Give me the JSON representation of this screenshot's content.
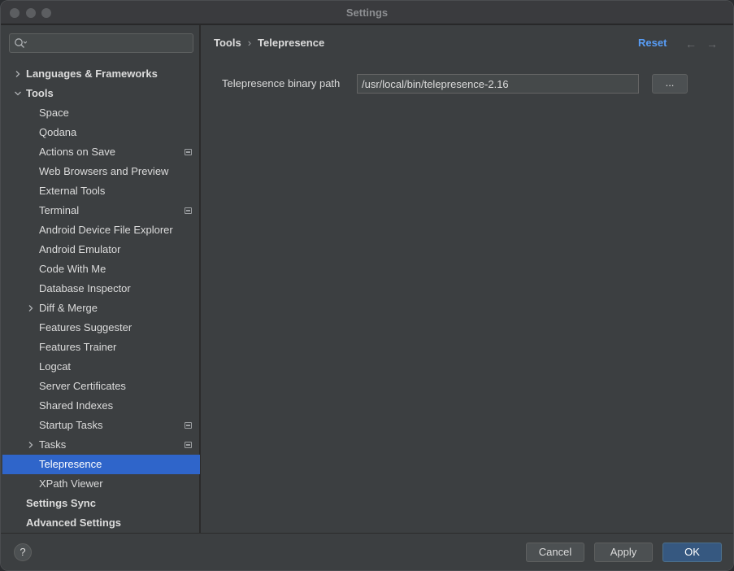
{
  "window": {
    "title": "Settings"
  },
  "search": {
    "placeholder": ""
  },
  "sidebar": {
    "items": [
      {
        "label": "Languages & Frameworks",
        "level": 0,
        "bold": true,
        "arrow": "collapsed"
      },
      {
        "label": "Tools",
        "level": 0,
        "bold": true,
        "arrow": "expanded"
      },
      {
        "label": "Space",
        "level": 1
      },
      {
        "label": "Qodana",
        "level": 1
      },
      {
        "label": "Actions on Save",
        "level": 1,
        "badge": true
      },
      {
        "label": "Web Browsers and Preview",
        "level": 1
      },
      {
        "label": "External Tools",
        "level": 1
      },
      {
        "label": "Terminal",
        "level": 1,
        "badge": true
      },
      {
        "label": "Android Device File Explorer",
        "level": 1
      },
      {
        "label": "Android Emulator",
        "level": 1
      },
      {
        "label": "Code With Me",
        "level": 1
      },
      {
        "label": "Database Inspector",
        "level": 1
      },
      {
        "label": "Diff & Merge",
        "level": 1,
        "arrow": "collapsed"
      },
      {
        "label": "Features Suggester",
        "level": 1
      },
      {
        "label": "Features Trainer",
        "level": 1
      },
      {
        "label": "Logcat",
        "level": 1
      },
      {
        "label": "Server Certificates",
        "level": 1
      },
      {
        "label": "Shared Indexes",
        "level": 1
      },
      {
        "label": "Startup Tasks",
        "level": 1,
        "badge": true
      },
      {
        "label": "Tasks",
        "level": 1,
        "arrow": "collapsed",
        "badge": true
      },
      {
        "label": "Telepresence",
        "level": 1,
        "selected": true
      },
      {
        "label": "XPath Viewer",
        "level": 1
      },
      {
        "label": "Settings Sync",
        "level": 0,
        "bold": true
      },
      {
        "label": "Advanced Settings",
        "level": 0,
        "bold": true
      }
    ]
  },
  "content": {
    "breadcrumb": {
      "parent": "Tools",
      "separator": "›",
      "current": "Telepresence"
    },
    "reset_label": "Reset",
    "back_icon": "←",
    "forward_icon": "→",
    "field_label": "Telepresence binary path",
    "field_value": "/usr/local/bin/telepresence-2.16",
    "browse_label": "..."
  },
  "footer": {
    "help_label": "?",
    "cancel_label": "Cancel",
    "apply_label": "Apply",
    "ok_label": "OK"
  },
  "colors": {
    "accent": "#2f65ca",
    "link": "#589df6",
    "panel": "#3c3f41",
    "ok_button": "#365880"
  }
}
